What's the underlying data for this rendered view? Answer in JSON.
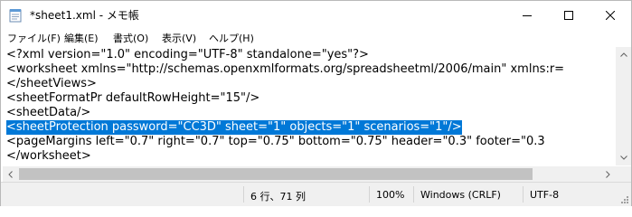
{
  "window": {
    "title": "*sheet1.xml - メモ帳",
    "icon": "notepad-icon",
    "controls": [
      "minimize-icon",
      "maximize-icon",
      "close-icon"
    ]
  },
  "menu": {
    "items": [
      {
        "label": "ファイル(F)"
      },
      {
        "label": "編集(E)"
      },
      {
        "label": "書式(O)"
      },
      {
        "label": "表示(V)"
      },
      {
        "label": "ヘルプ(H)"
      }
    ]
  },
  "editor": {
    "lines": [
      "<?xml version=\"1.0\" encoding=\"UTF-8\" standalone=\"yes\"?>",
      "<worksheet xmlns=\"http://schemas.openxmlformats.org/spreadsheetml/2006/main\" xmlns:r=",
      "</sheetViews>",
      "<sheetFormatPr defaultRowHeight=\"15\"/>",
      "<sheetData/>",
      "<sheetProtection password=\"CC3D\" sheet=\"1\" objects=\"1\" scenarios=\"1\"/>",
      "<pageMargins left=\"0.7\" right=\"0.7\" top=\"0.75\" bottom=\"0.75\" header=\"0.3\" footer=\"0.3",
      "</worksheet>"
    ],
    "selected_line_index": 5,
    "selection_color": "#0078d7"
  },
  "status": {
    "position": "6 行、71 列",
    "zoom": "100%",
    "line_ending": "Windows (CRLF)",
    "encoding": "UTF-8"
  }
}
